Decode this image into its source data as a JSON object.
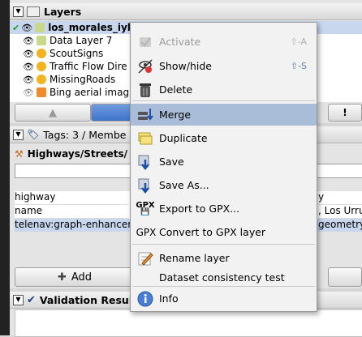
{
  "layers_panel": {
    "title": "Layers",
    "items": [
      {
        "name": "los_morales_iyla.osm",
        "icon": "osm-layer-icon",
        "active": true
      },
      {
        "name": "Data Layer 7",
        "icon": "osm-layer-icon"
      },
      {
        "name": "ScoutSigns",
        "icon": "scout-icon"
      },
      {
        "name": "Traffic Flow Dire",
        "icon": "scout-icon"
      },
      {
        "name": "MissingRoads",
        "icon": "scout-icon"
      },
      {
        "name": "Bing aerial imag",
        "icon": "imagery-icon"
      }
    ]
  },
  "tags_panel": {
    "title": "Tags: 3 / Membe",
    "preset": "Highways/Streets/",
    "rows": [
      {
        "key": "highway",
        "value": "y"
      },
      {
        "key": "name",
        "value": ", Los Urru"
      },
      {
        "key": "telenav:graph-enhancer",
        "value": "geometry"
      }
    ],
    "add_label": "Add"
  },
  "validation_panel": {
    "title": "Validation Result"
  },
  "context_menu": {
    "items": [
      {
        "label": "Activate",
        "accel": "⇧-A",
        "disabled": true,
        "icon": "activate-icon"
      },
      {
        "label": "Show/hide",
        "accel": "⇧-S",
        "icon": "eye-hidden-icon"
      },
      {
        "label": "Delete",
        "icon": "trash-icon"
      },
      {
        "label": "Merge",
        "highlighted": true,
        "icon": "merge-icon"
      },
      {
        "label": "Duplicate",
        "icon": "duplicate-icon"
      },
      {
        "label": "Save",
        "icon": "save-icon"
      },
      {
        "label": "Save As...",
        "icon": "save-as-icon"
      },
      {
        "label": "Export to GPX...",
        "icon": "gpx-export-icon"
      },
      {
        "label": "Convert to GPX layer",
        "icon": "gpx-text"
      },
      {
        "label": "Rename layer",
        "icon": "rename-icon"
      },
      {
        "label": "Dataset consistency test"
      },
      {
        "label": "Info",
        "icon": "info-icon"
      }
    ],
    "gpx_text": "GPX"
  },
  "colors": {
    "menu_highlight": "#a9bdd9",
    "selection_row": "#c8d6ee",
    "accelerator": "#6a7fa6"
  }
}
